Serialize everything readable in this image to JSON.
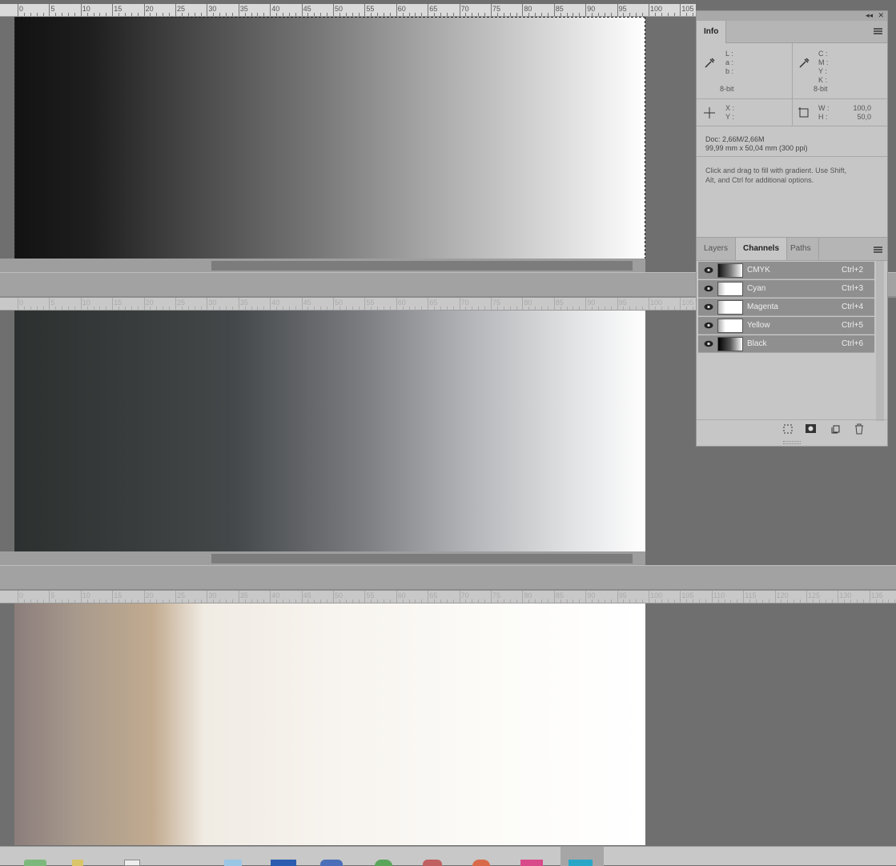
{
  "ruler_labels": [
    "0",
    "5",
    "10",
    "15",
    "20",
    "25",
    "30",
    "35",
    "40",
    "45",
    "50",
    "55",
    "60",
    "65",
    "70",
    "75",
    "80",
    "85",
    "90",
    "95",
    "100",
    "105",
    "110",
    "115",
    "120",
    "125",
    "130",
    "135"
  ],
  "info_panel": {
    "tab_info": "Info",
    "lab_labels": {
      "L": "L :",
      "a": "a :",
      "b": "b :"
    },
    "lab_bit": "8-bit",
    "cmyk_labels": {
      "C": "C :",
      "M": "M :",
      "Y": "Y :",
      "K": "K :"
    },
    "cmyk_bit": "8-bit",
    "xy_labels": {
      "X": "X :",
      "Y": "Y :"
    },
    "wh": {
      "W_label": "W :",
      "H_label": "H :",
      "W_value": "100,0",
      "H_value": "50,0"
    },
    "doc_size": "Doc: 2,66M/2,66M",
    "dimensions": "99,99 mm x 50,04 mm (300 ppi)",
    "hint_line1": "Click and drag to fill with gradient.  Use Shift,",
    "hint_line2": "Alt, and Ctrl for additional options."
  },
  "channels_panel": {
    "tabs": [
      "Layers",
      "Channels",
      "Paths"
    ],
    "active_tab": "Channels",
    "channels": [
      {
        "name": "CMYK",
        "shortcut": "Ctrl+2"
      },
      {
        "name": "Cyan",
        "shortcut": "Ctrl+3"
      },
      {
        "name": "Magenta",
        "shortcut": "Ctrl+4"
      },
      {
        "name": "Yellow",
        "shortcut": "Ctrl+5"
      },
      {
        "name": "Black",
        "shortcut": "Ctrl+6"
      }
    ]
  },
  "colors": {
    "canvas_bg": "#6f6f6f",
    "panel_bg": "#c6c6c6",
    "row_selected": "#8f8f8f"
  }
}
